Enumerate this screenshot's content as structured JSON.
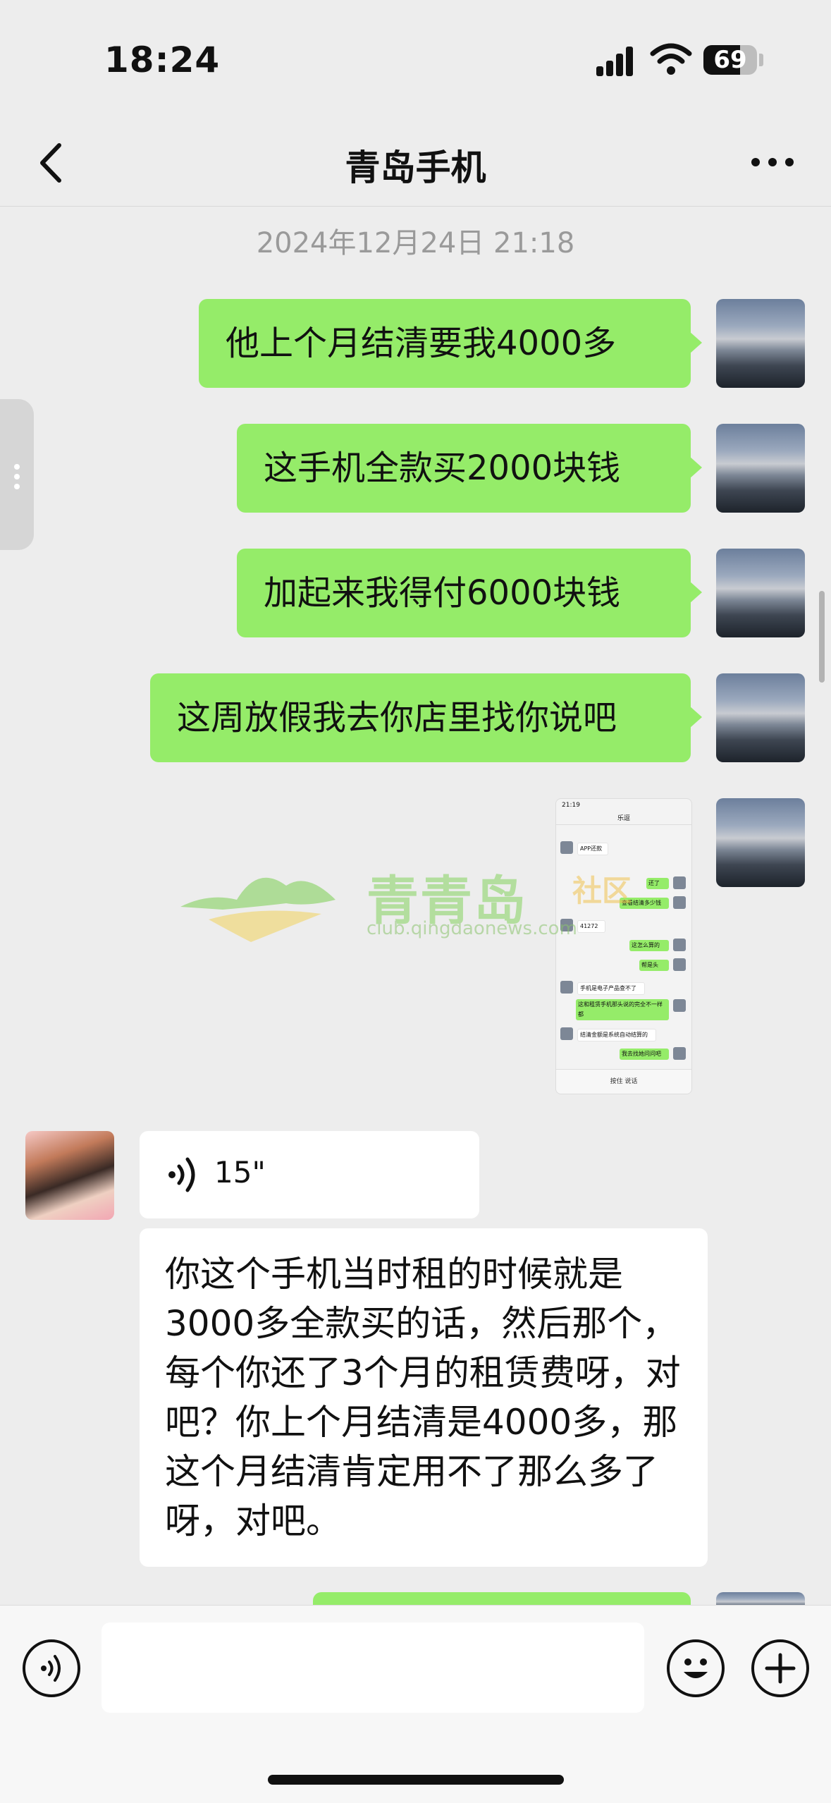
{
  "status_bar": {
    "time": "18:24",
    "battery": "69",
    "battery_level": 0.69
  },
  "nav": {
    "title": "青岛手机"
  },
  "timestamp": "2024年12月24日 21:18",
  "messages_out": [
    {
      "text": "他上个月结清要我4000多"
    },
    {
      "text": "这手机全款买2000块钱"
    },
    {
      "text": "加起来我得付6000块钱"
    },
    {
      "text": "这周放假我去你店里找你说吧"
    }
  ],
  "thumbnail": {
    "time": "21:19",
    "title": "乐逗",
    "messages": [
      "APP还款",
      "还了",
      "查看结清多少钱",
      "41272",
      "这怎么算的",
      "帮是头",
      "手机是电子产品查不了",
      "这和租赁手机那头说的完全不一样都",
      "结清金额是系统自动结算的",
      "我去找她问问吧"
    ],
    "input_hint": "按住 说话"
  },
  "watermark": {
    "brand": "青青岛",
    "community": "社区",
    "url": "club.qingdaonews.com"
  },
  "voice_message": {
    "duration": "15\""
  },
  "incoming_text": "你这个手机当时租的时候就是3000多全款买的话，然后那个，每个你还了3个月的租赁费呀，对吧？你上个月结清是4000多，那这个月结清肯定用不了那么多了呀，对吧。",
  "input": {
    "value": ""
  },
  "icons": {
    "back": "chevron-left-icon",
    "more": "more-icon",
    "voice": "voice-icon",
    "emoji": "emoji-icon",
    "plus": "plus-icon"
  }
}
